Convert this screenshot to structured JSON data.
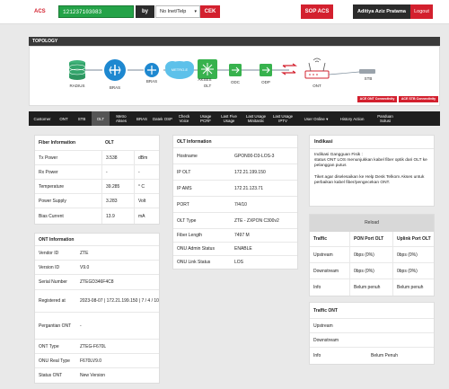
{
  "header": {
    "acs_label": "ACS",
    "search_value": "121237103083",
    "by_label": "by",
    "search_type": "No Inet/Telp",
    "cek_label": "CEK",
    "sop_label": "SOP ACS",
    "user_name": "Aditiya Aziz Pratama",
    "logout_label": "Logout"
  },
  "topology": {
    "title": "TOPOLOGY",
    "nodes": {
      "radius": "RADIUS",
      "bras": "BRAS",
      "bras2": "BRAS",
      "metro": "METRO-E",
      "akses": "AKSES",
      "olt": "OLT",
      "odc": "ODC",
      "odp": "ODP",
      "stb": "STB",
      "ont": "ONT"
    },
    "ace_ont": "ACE ONT Connectivity",
    "ace_stb": "ACE STB Connectivity"
  },
  "tabs": [
    "Customer",
    "ONT",
    "STB",
    "OLT",
    "Metro Akses",
    "BRAS",
    "Datek OSP",
    "Check Voice",
    "Usage PCRF",
    "Last Five Usage",
    "Last Usage Minitastic",
    "Last Usage IPTV",
    "User Online",
    "History Action",
    "Panduan Solusi"
  ],
  "fiber": {
    "title": "Fiber Information",
    "col": "OLT",
    "rows": [
      {
        "label": "Tx Power",
        "value": "3.538",
        "unit": "dBm"
      },
      {
        "label": "Rx Power",
        "value": "-",
        "unit": "-"
      },
      {
        "label": "Temperature",
        "value": "39.285",
        "unit": "° C"
      },
      {
        "label": "Power Supply",
        "value": "3.283",
        "unit": "Volt"
      },
      {
        "label": "Bias Current",
        "value": "13.9",
        "unit": "mA"
      }
    ]
  },
  "ont_info": {
    "title": "ONT Information",
    "rows": [
      {
        "label": "Vendor ID",
        "value": "ZTE"
      },
      {
        "label": "Version ID",
        "value": "V9.0"
      },
      {
        "label": "Serial Number",
        "value": "ZTEGD346F4C8"
      },
      {
        "label": "Registered at",
        "value": "2023-08-07 | 172.21.199.150 | 7 / 4 / 10"
      },
      {
        "label": "Pergantian ONT",
        "value": "-"
      },
      {
        "label": "ONT Type",
        "value": "ZTEG-F670L"
      },
      {
        "label": "ONU Real Type",
        "value": "F670LV9.0"
      },
      {
        "label": "Status ONT",
        "value": "New Version"
      }
    ]
  },
  "olt_info": {
    "title": "OLT Information",
    "rows": [
      {
        "label": "Hostname",
        "value": "GPON00-D3-LOS-3"
      },
      {
        "label": "IP OLT",
        "value": "172.21.199.150"
      },
      {
        "label": "IP AMS",
        "value": "172.21.123.71"
      },
      {
        "label": "PORT",
        "value": "7/4/10"
      },
      {
        "label": "OLT Type",
        "value": "ZTE - ZXPON C300v2"
      },
      {
        "label": "Fiber Length",
        "value": "7497 M"
      },
      {
        "label": "ONU Admin Status",
        "value": "ENABLE"
      },
      {
        "label": "ONU Link Status",
        "value": "LOS"
      }
    ]
  },
  "indikasi": {
    "title": "Indikasi",
    "line1": "Indikasi Gangguan Fisik :",
    "line2": "status ONT LOS menunjukkan kabel fiber optik dari OLT ke pelanggan putus",
    "line3": "Tiket agar diselesaikan ke Help Desk Telkom Akses untuk perbaikan kabel fiber/pengecekan ONT."
  },
  "traffic": {
    "reload_label": "Reload",
    "headers": [
      "Traffic",
      "PON Port OLT",
      "Uplink Port OLT"
    ],
    "rows": [
      [
        "Upstream",
        "0bps (0%)",
        "0bps (0%)"
      ],
      [
        "Downstream",
        "0bps (0%)",
        "0bps (0%)"
      ],
      [
        "Info",
        "Belum penuh",
        "Belum penuh"
      ]
    ]
  },
  "traffic_ont": {
    "title": "Traffic ONT",
    "rows": [
      {
        "label": "Upstream",
        "value": ""
      },
      {
        "label": "Downstream",
        "value": ""
      },
      {
        "label": "Info",
        "value": "Belum Penuh"
      }
    ]
  },
  "colors": {
    "brand_red": "#d3202e",
    "search_green": "#24a348",
    "dark": "#1e1e1e"
  }
}
